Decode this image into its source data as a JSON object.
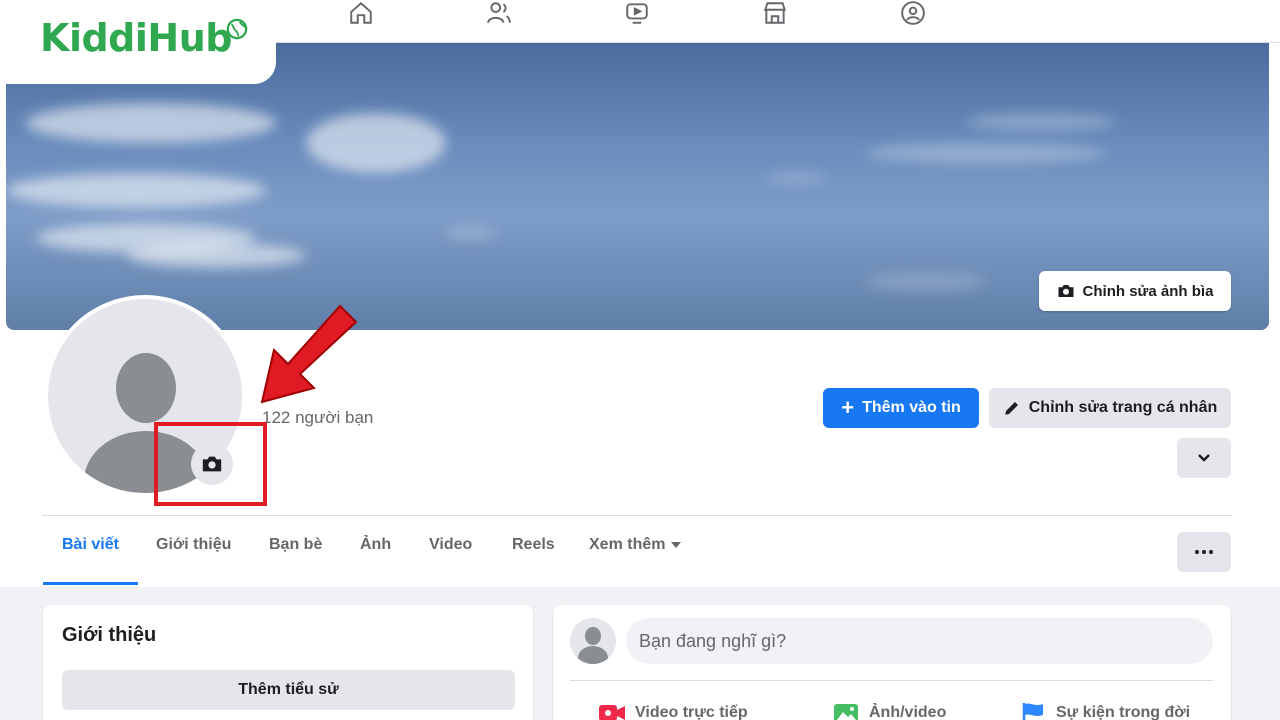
{
  "logo": {
    "text": "KiddiHub"
  },
  "cover": {
    "edit_label": "Chỉnh sửa ảnh bìa"
  },
  "profile": {
    "friends_count": "122 người bạn"
  },
  "actions": {
    "add_story": "Thêm vào tin",
    "edit_profile": "Chỉnh sửa trang cá nhân"
  },
  "tabs": [
    {
      "label": "Bài viết"
    },
    {
      "label": "Giới thiệu"
    },
    {
      "label": "Bạn bè"
    },
    {
      "label": "Ảnh"
    },
    {
      "label": "Video"
    },
    {
      "label": "Reels"
    },
    {
      "label": "Xem thêm"
    }
  ],
  "intro": {
    "title": "Giới thiệu",
    "add_bio": "Thêm tiểu sử"
  },
  "composer": {
    "placeholder": "Bạn đang nghĩ gì?",
    "actions": [
      {
        "label": "Video trực tiếp"
      },
      {
        "label": "Ảnh/video"
      },
      {
        "label": "Sự kiện trong đời"
      }
    ]
  },
  "colors": {
    "primary": "#1877f2",
    "highlight": "#e01b24",
    "brand": "#2fa84f"
  }
}
